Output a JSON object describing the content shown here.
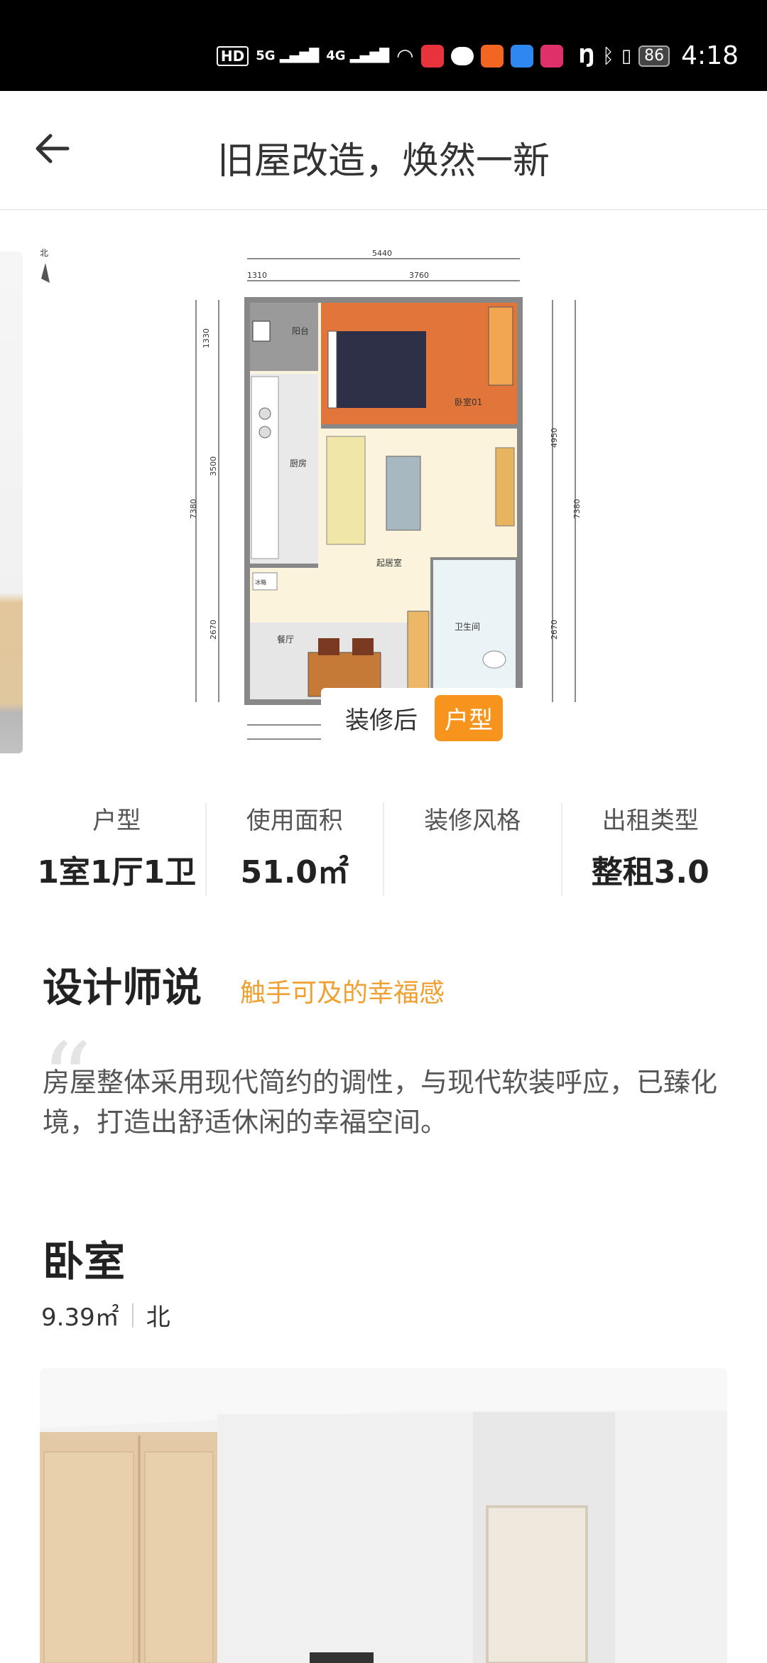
{
  "status_bar": {
    "network_badge": "HD",
    "signal_1": "5G",
    "signal_2": "4G",
    "battery": "86",
    "time": "4:18"
  },
  "nav": {
    "title": "旧屋改造，焕然一新"
  },
  "gallery": {
    "after_label": "装修后",
    "type_label": "户型",
    "plan": {
      "north": "北",
      "total_width": "5440",
      "width_left": "1310",
      "width_right": "3760",
      "height_total": "7380",
      "height_left_1": "1330",
      "height_left_2": "3500",
      "height_left_3": "2670",
      "height_right_1": "4950",
      "height_right_2": "2670",
      "rooms": {
        "balcony": "阳台",
        "bedroom": "卧室01",
        "kitchen": "厨房",
        "living": "起居室",
        "fridge": "冰箱",
        "dining": "餐厅",
        "bathroom": "卫生间"
      }
    }
  },
  "stats": [
    {
      "label": "户型",
      "value": "1室1厅1卫"
    },
    {
      "label": "使用面积",
      "value": "51.0㎡"
    },
    {
      "label": "装修风格",
      "value": ""
    },
    {
      "label": "出租类型",
      "value": "整租3.0"
    }
  ],
  "designer": {
    "title": "设计师说",
    "subtitle": "触手可及的幸福感",
    "quote_mark": "“",
    "description": "房屋整体采用现代简约的调性，与现代软装呼应，已臻化境，打造出舒适休闲的幸福空间。"
  },
  "room": {
    "name": "卧室",
    "area": "9.39㎡",
    "orientation": "北"
  },
  "colors": {
    "accent": "#f7941d",
    "subtitle": "#f0a030",
    "status_bar": "#000000"
  }
}
